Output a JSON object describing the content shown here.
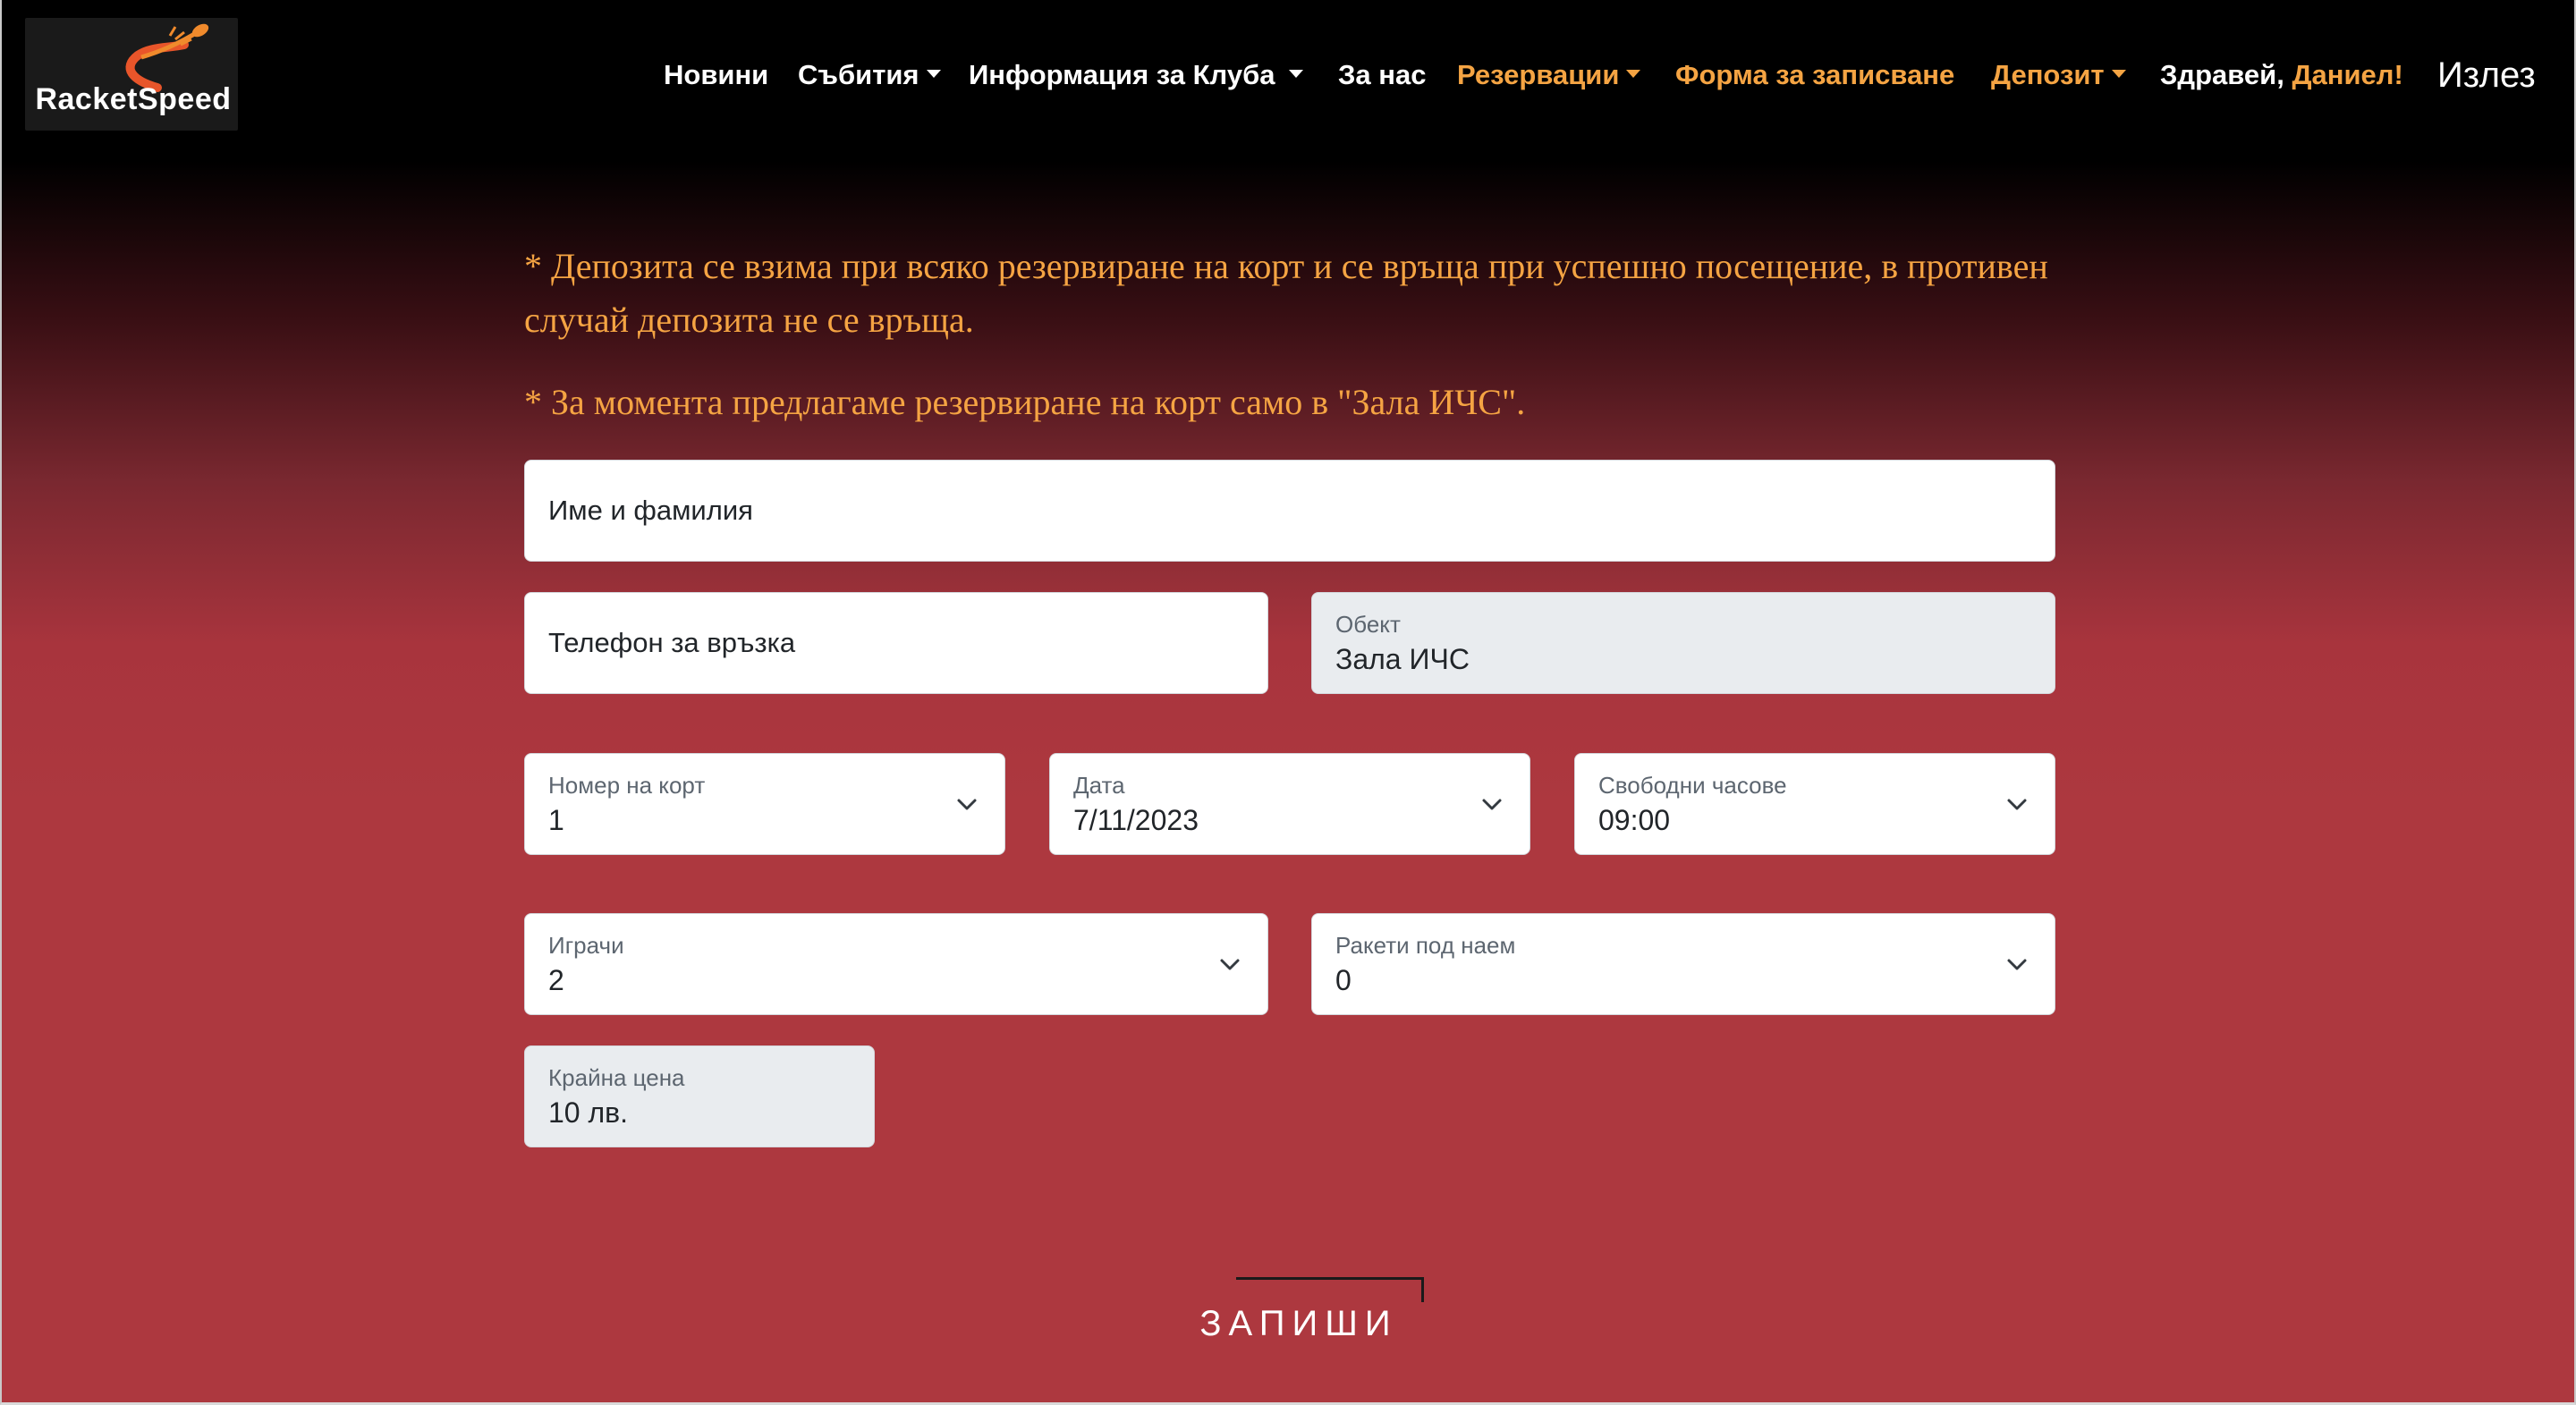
{
  "logo": {
    "text": "RacketSpeed"
  },
  "nav": {
    "items": [
      {
        "label": "Новини",
        "dropdown": false,
        "highlight": false
      },
      {
        "label": "Събития",
        "dropdown": true,
        "highlight": false
      },
      {
        "label": "Информация за Клуба",
        "dropdown": true,
        "highlight": false
      },
      {
        "label": "За нас",
        "dropdown": false,
        "highlight": false
      },
      {
        "label": "Резервации",
        "dropdown": true,
        "highlight": true
      },
      {
        "label": "Форма за записване",
        "dropdown": false,
        "highlight": true
      },
      {
        "label": "Депозит",
        "dropdown": true,
        "highlight": true
      }
    ],
    "greeting": "Здравей, ",
    "user_name": "Даниел!",
    "logout": "Излез"
  },
  "notes": [
    "* Депозита се взима при всяко резервиране на корт и се връща при успешно посещение, в противен случай депозита не се връща.",
    "* За момента предлагаме резервиране на корт само в \"Зала ИЧС\"."
  ],
  "form": {
    "name": {
      "placeholder": "Име и фамилия"
    },
    "phone": {
      "placeholder": "Телефон за връзка"
    },
    "venue": {
      "label": "Обект",
      "value": "Зала ИЧС"
    },
    "court": {
      "label": "Номер на корт",
      "value": "1"
    },
    "date": {
      "label": "Дата",
      "value": "7/11/2023"
    },
    "hours": {
      "label": "Свободни часове",
      "value": "09:00"
    },
    "players": {
      "label": "Играчи",
      "value": "2"
    },
    "rackets": {
      "label": "Ракети под наем",
      "value": "0"
    },
    "price": {
      "label": "Крайна цена",
      "value": "10 лв."
    },
    "submit": "ЗАПИШИ"
  },
  "colors": {
    "accent": "#f5a443",
    "background_bottom": "#ad383f",
    "nav_bg": "#000000"
  },
  "icons": [
    "rocket-logo-icon",
    "chevron-down-icon",
    "caret-down-icon"
  ]
}
